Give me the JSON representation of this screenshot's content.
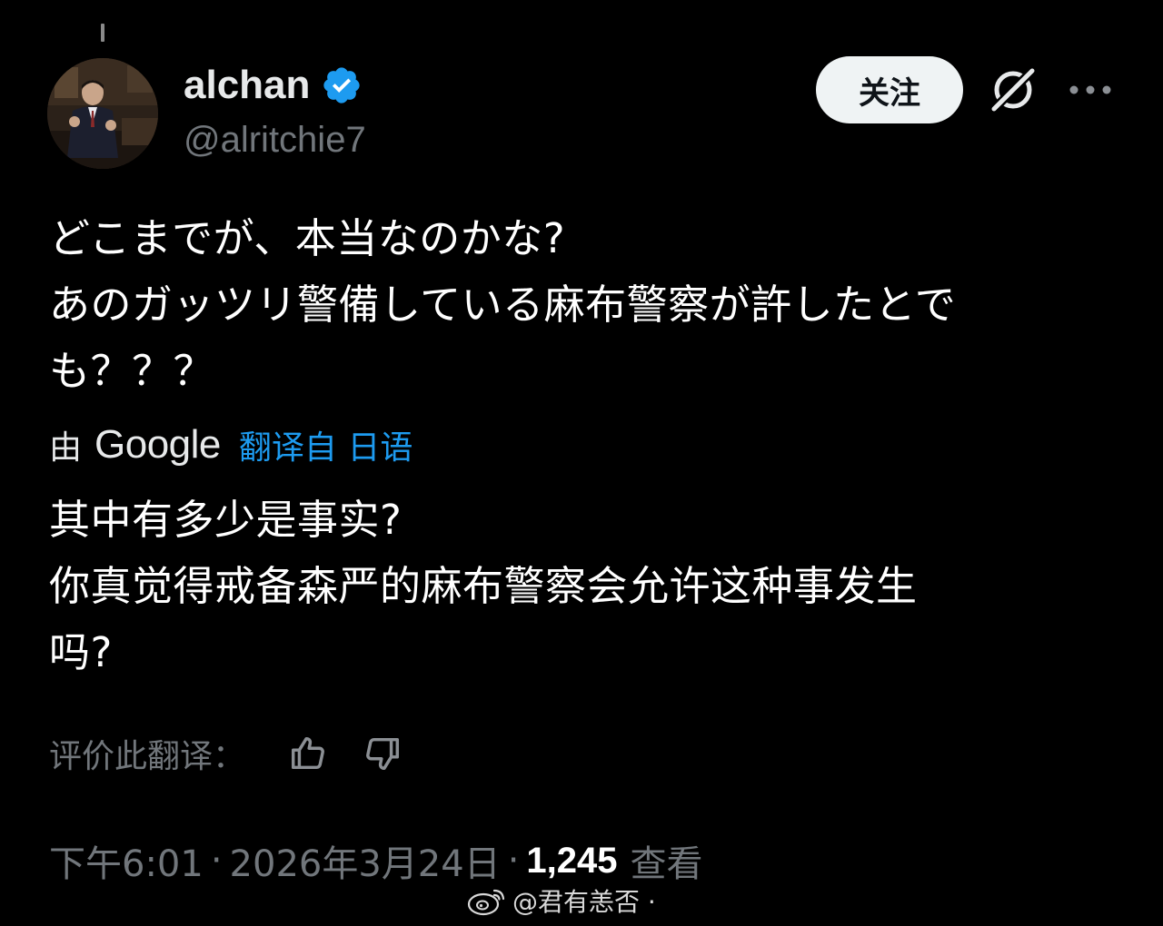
{
  "author": {
    "display_name": "alchan",
    "handle": "@alritchie7",
    "verified_icon": "verified-badge-icon",
    "verified_color": "#1d9bf0"
  },
  "header_actions": {
    "follow_label": "关注",
    "grok_icon": "grok-icon",
    "more_icon": "more-icon"
  },
  "post": {
    "original_text": "どこまでが、本当なのかな?\nあのガッツリ警備している麻布警察が許したとで\nも？？？",
    "translation": {
      "by_label": "由",
      "provider": "Google",
      "translated_from": "翻译自 日语",
      "text": "其中有多少是事实?\n你真觉得戒备森严的麻布警察会允许这种事发生\n吗?"
    },
    "rate_label": "评价此翻译：",
    "rate_icons": [
      "thumbs-up-icon",
      "thumbs-down-icon"
    ]
  },
  "meta": {
    "time": "下午6:01",
    "separator": "·",
    "date": "2026年3月24日",
    "views_count": "1,245",
    "views_label": "查看"
  },
  "watermark": {
    "text": "@君有恙否 ·",
    "logo_icon": "weibo-logo-icon"
  },
  "colors": {
    "background": "#000000",
    "primary_text": "#ffffff",
    "secondary_text": "#71767b",
    "link": "#1d9bf0",
    "button_bg": "#eff3f4"
  }
}
